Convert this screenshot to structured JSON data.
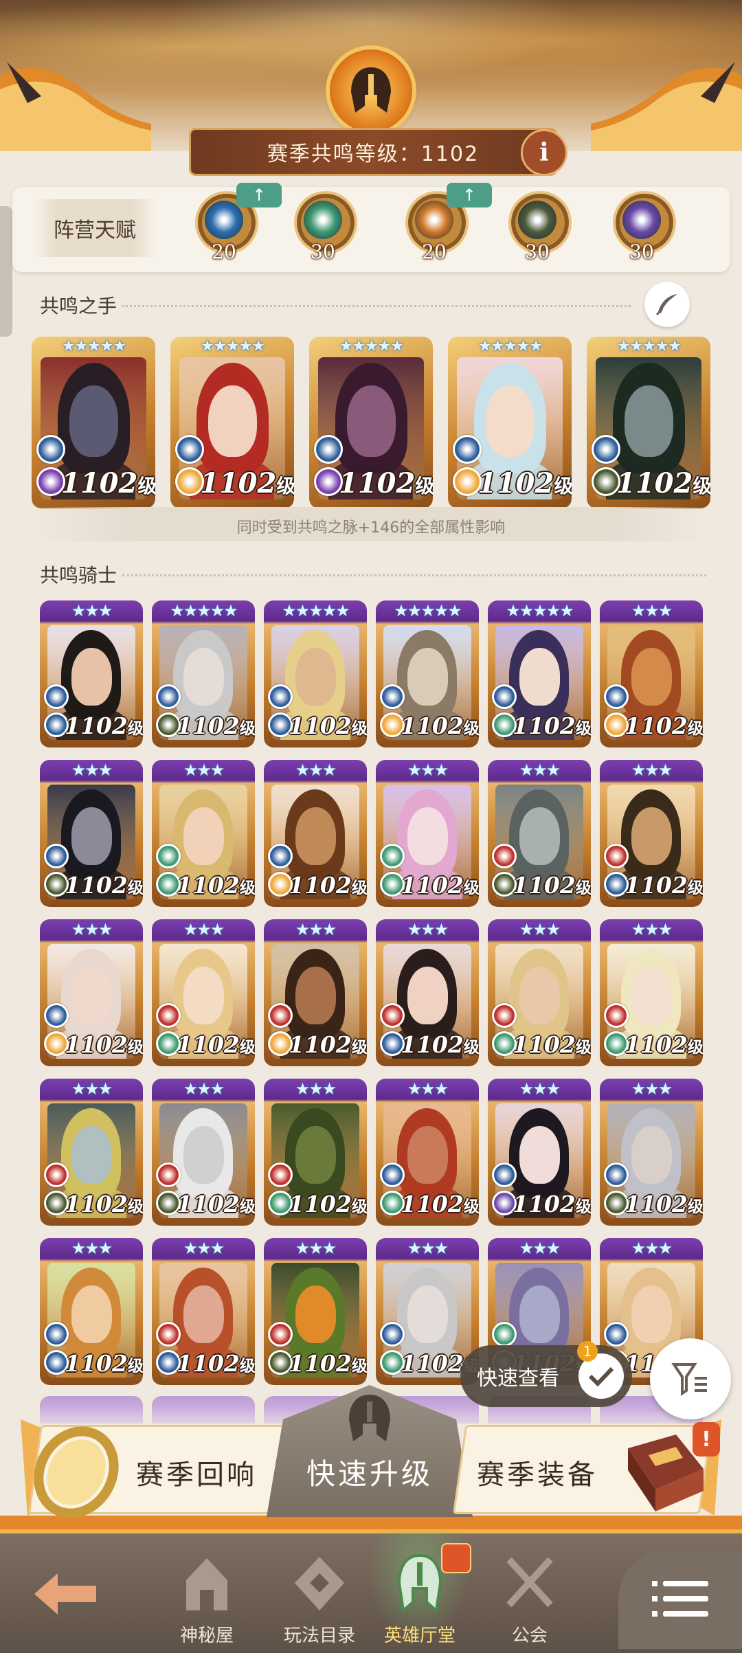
{
  "header": {
    "season_label": "赛季共鸣等级：1102",
    "info_label": "i"
  },
  "faction_talent": {
    "title": "阵营天赋",
    "items": [
      {
        "name": "light-bearers",
        "level": "20",
        "upgrade": true,
        "color": "#2c6fb0"
      },
      {
        "name": "wilders",
        "level": "30",
        "upgrade": false,
        "color": "#3f9a72"
      },
      {
        "name": "maulers",
        "level": "20",
        "upgrade": true,
        "color": "#d07a2a"
      },
      {
        "name": "graveborn",
        "level": "30",
        "upgrade": false,
        "color": "#4d5b3a"
      },
      {
        "name": "celestial-hypogean",
        "level": "30",
        "upgrade": false,
        "color": "#6a4aa8"
      }
    ],
    "upgrade_arrow": "↑"
  },
  "resonance_hands": {
    "title": "共鸣之手",
    "note": "同时受到共鸣之脉+146的全部属性影响",
    "heroes": [
      {
        "level": "1102",
        "unit": "级",
        "stars": "★★★★★",
        "skin": "#5a5b72",
        "hair": "#2a1e26",
        "bg": "#8a2f2a",
        "c1": "#2e5e9a",
        "c2": "#7a3fb0"
      },
      {
        "level": "1102",
        "unit": "级",
        "stars": "★★★★★",
        "skin": "#f1d2bf",
        "hair": "#b42b24",
        "bg": "#e8c4a4",
        "c1": "#2e5e9a",
        "c2": "#f0a83a"
      },
      {
        "level": "1102",
        "unit": "级",
        "stars": "★★★★★",
        "skin": "#8a5a7a",
        "hair": "#3a1a2e",
        "bg": "#5a2a3a",
        "c1": "#2e5e9a",
        "c2": "#7a3fb0"
      },
      {
        "level": "1102",
        "unit": "级",
        "stars": "★★★★★",
        "skin": "#f4dccb",
        "hair": "#c9e2ea",
        "bg": "#f0d6d8",
        "c1": "#2e5e9a",
        "c2": "#f0a83a"
      },
      {
        "level": "1102",
        "unit": "级",
        "stars": "★★★★★",
        "skin": "#7a8a8a",
        "hair": "#1c2a22",
        "bg": "#2d3d3a",
        "c1": "#2e5e9a",
        "c2": "#4a5a30"
      }
    ]
  },
  "resonance_knights": {
    "title": "共鸣骑士",
    "heroes": [
      {
        "level": "1102",
        "unit": "级",
        "stars": "★★★",
        "skin": "#e8c2a6",
        "hair": "#1e1a18",
        "bg": "#e9dfe8",
        "c1": "#2e5e9a",
        "c2": "#2e5e9a"
      },
      {
        "level": "1102",
        "unit": "级",
        "stars": "★★★★★",
        "skin": "#e4dcd6",
        "hair": "#c9c9c9",
        "bg": "#b8b0b8",
        "c1": "#2e5e9a",
        "c2": "#4a5a30"
      },
      {
        "level": "1102",
        "unit": "级",
        "stars": "★★★★★",
        "skin": "#e0b890",
        "hair": "#e6cf8a",
        "bg": "#d9d0e6",
        "c1": "#2e5e9a",
        "c2": "#2e5e9a"
      },
      {
        "level": "1102",
        "unit": "级",
        "stars": "★★★★★",
        "skin": "#d8cbb8",
        "hair": "#8a7a66",
        "bg": "#d4dcf0",
        "c1": "#2e5e9a",
        "c2": "#f0a83a"
      },
      {
        "level": "1102",
        "unit": "级",
        "stars": "★★★★★",
        "skin": "#f0dccf",
        "hair": "#3a2f5a",
        "bg": "#c8b8e2",
        "c1": "#2e5e9a",
        "c2": "#3f9a72"
      },
      {
        "level": "1102",
        "unit": "级",
        "stars": "★★★",
        "skin": "#d48a4a",
        "hair": "#a44a22",
        "bg": "#e4bd7a",
        "c1": "#2e5e9a",
        "c2": "#f0a83a"
      },
      {
        "level": "1102",
        "unit": "级",
        "stars": "★★★",
        "skin": "#8a8a98",
        "hair": "#1a1820",
        "bg": "#3a3a4a",
        "c1": "#2e5e9a",
        "c2": "#4a5a30"
      },
      {
        "level": "1102",
        "unit": "级",
        "stars": "★★★",
        "skin": "#f1d2b8",
        "hair": "#d9b870",
        "bg": "#e8d2a0",
        "c1": "#3f9a72",
        "c2": "#3f9a72"
      },
      {
        "level": "1102",
        "unit": "级",
        "stars": "★★★",
        "skin": "#c08a58",
        "hair": "#6a3a1a",
        "bg": "#f0e0d0",
        "c1": "#2e5e9a",
        "c2": "#f0a83a"
      },
      {
        "level": "1102",
        "unit": "级",
        "stars": "★★★",
        "skin": "#f4dde0",
        "hair": "#e2a8d0",
        "bg": "#d8c0e8",
        "c1": "#3f9a72",
        "c2": "#3f9a72"
      },
      {
        "level": "1102",
        "unit": "级",
        "stars": "★★★",
        "skin": "#a8b0b0",
        "hair": "#5a6262",
        "bg": "#7a8282",
        "c1": "#c0302a",
        "c2": "#4a5a30"
      },
      {
        "level": "1102",
        "unit": "级",
        "stars": "★★★",
        "skin": "#c89a6a",
        "hair": "#3a2a1a",
        "bg": "#f0d8b0",
        "c1": "#c0302a",
        "c2": "#2e5e9a"
      },
      {
        "level": "1102",
        "unit": "级",
        "stars": "★★★",
        "skin": "#f0d8cc",
        "hair": "#e8d8d0",
        "bg": "#f2e8e4",
        "c1": "#2e5e9a",
        "c2": "#f0a83a"
      },
      {
        "level": "1102",
        "unit": "级",
        "stars": "★★★",
        "skin": "#f4dcc4",
        "hair": "#e8c88a",
        "bg": "#f4e6d0",
        "c1": "#c0302a",
        "c2": "#3f9a72"
      },
      {
        "level": "1102",
        "unit": "级",
        "stars": "★★★",
        "skin": "#a8704a",
        "hair": "#3a2418",
        "bg": "#d4c0a8",
        "c1": "#c0302a",
        "c2": "#f0a83a"
      },
      {
        "level": "1102",
        "unit": "级",
        "stars": "★★★",
        "skin": "#f0d2c4",
        "hair": "#2a1e1c",
        "bg": "#e8d8d8",
        "c1": "#c0302a",
        "c2": "#2e5e9a"
      },
      {
        "level": "1102",
        "unit": "级",
        "stars": "★★★",
        "skin": "#e8c8a8",
        "hair": "#e0c48a",
        "bg": "#f0e0c8",
        "c1": "#c0302a",
        "c2": "#3f9a72"
      },
      {
        "level": "1102",
        "unit": "级",
        "stars": "★★★",
        "skin": "#f4e0d0",
        "hair": "#f0e6c0",
        "bg": "#f4ecd8",
        "c1": "#c0302a",
        "c2": "#3f9a72"
      },
      {
        "level": "1102",
        "unit": "级",
        "stars": "★★★",
        "skin": "#b0c0c0",
        "hair": "#d0c060",
        "bg": "#4a5a5a",
        "c1": "#c0302a",
        "c2": "#4a5a30"
      },
      {
        "level": "1102",
        "unit": "级",
        "stars": "★★★",
        "skin": "#d0d0d0",
        "hair": "#e8e8e8",
        "bg": "#8a8a90",
        "c1": "#c0302a",
        "c2": "#4a5a30"
      },
      {
        "level": "1102",
        "unit": "级",
        "stars": "★★★",
        "skin": "#6a7a3a",
        "hair": "#3a4a20",
        "bg": "#4a5a2a",
        "c1": "#c0302a",
        "c2": "#3f9a72"
      },
      {
        "level": "1102",
        "unit": "级",
        "stars": "★★★",
        "skin": "#c87a5a",
        "hair": "#b03a22",
        "bg": "#e8b890",
        "c1": "#2e5e9a",
        "c2": "#3f9a72"
      },
      {
        "level": "1102",
        "unit": "级",
        "stars": "★★★",
        "skin": "#f0dcd8",
        "hair": "#1e1820",
        "bg": "#e8d4d8",
        "c1": "#2e5e9a",
        "c2": "#6a4aa8"
      },
      {
        "level": "1102",
        "unit": "级",
        "stars": "★★★",
        "skin": "#d8d0c8",
        "hair": "#c0c0c8",
        "bg": "#b0b0b8",
        "c1": "#2e5e9a",
        "c2": "#4a5a30"
      },
      {
        "level": "1102",
        "unit": "级",
        "stars": "★★★",
        "skin": "#f0caa0",
        "hair": "#d08a3a",
        "bg": "#d8e0a0",
        "c1": "#2e5e9a",
        "c2": "#2e5e9a"
      },
      {
        "level": "1102",
        "unit": "级",
        "stars": "★★★",
        "skin": "#e0a890",
        "hair": "#b8502a",
        "bg": "#e8c4a0",
        "c1": "#c0302a",
        "c2": "#2e5e9a"
      },
      {
        "level": "1102",
        "unit": "级",
        "stars": "★★★",
        "skin": "#e08a2a",
        "hair": "#5a7a2a",
        "bg": "#3a4a2a",
        "c1": "#c0302a",
        "c2": "#4a5a30"
      },
      {
        "level": "1102",
        "unit": "级",
        "stars": "★★★",
        "skin": "#e4dcd8",
        "hair": "#c8c8c8",
        "bg": "#d0d0d8",
        "c1": "#2e5e9a",
        "c2": "#3f9a72"
      },
      {
        "level": "1102",
        "unit": "级",
        "stars": "★★★",
        "skin": "#a8a8c8",
        "hair": "#7a70a0",
        "bg": "#9890b8",
        "c1": "#3f9a72",
        "c2": "#3f9a72"
      },
      {
        "level": "1102",
        "unit": "级",
        "stars": "★★★",
        "skin": "#f0d0b0",
        "hair": "#e4c08a",
        "bg": "#f0dcc0",
        "c1": "#2e5e9a",
        "c2": "#f0a83a"
      }
    ]
  },
  "quick_view": {
    "label": "快速查看",
    "badge": "1"
  },
  "actions": {
    "season_echo": "赛季回响",
    "quick_upgrade": "快速升级",
    "season_gear": "赛季装备",
    "gear_badge": "!"
  },
  "nav": {
    "items": [
      {
        "label": "神秘屋"
      },
      {
        "label": "玩法目录"
      },
      {
        "label": "英雄厅堂"
      },
      {
        "label": "公会"
      }
    ]
  },
  "colors": {
    "accent": "#f0b44a",
    "active_nav": "#ffe07a"
  }
}
